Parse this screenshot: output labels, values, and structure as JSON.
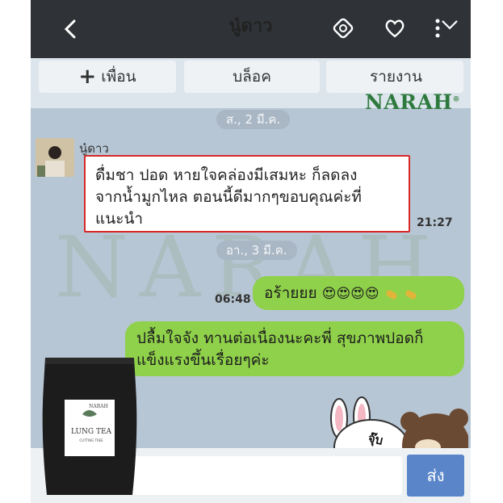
{
  "header": {
    "title": "นู๋ดาว",
    "back_icon": "chevron-left-icon",
    "icons": [
      "sync-icon",
      "heart-icon",
      "more-icon"
    ]
  },
  "actions": {
    "add_friend": "เพื่อน",
    "block": "บล็อค",
    "report": "รายงาน"
  },
  "brand": {
    "name": "NARAH",
    "mark": "®",
    "color": "#2e7a3e"
  },
  "watermark": "NARAH",
  "dates": {
    "first": "ส., 2 มี.ค.",
    "second": "อา., 3 มี.ค."
  },
  "messages": {
    "incoming": {
      "sender": "นู๋ดาว",
      "text_line1": "ดื่มชา ปอด หายใจคล่องมีเสมหะ ก็ลดลง",
      "text_line2": "จากน้ำมูกไหล ตอนนี้ดีมากๆขอบคุณค่ะที่",
      "text_line3": "แนะนำ",
      "time": "21:27"
    },
    "outgoing1": {
      "text": "อร้ายยย",
      "emoji": "😍😍😍😍",
      "time": "06:48"
    },
    "outgoing2": {
      "line1": "ปลื้มใจจัง ทานต่อเนื่องนะคะพี่ สุขภาพปอดก็",
      "line2": "แข็งแรงขึ้นเรื่อยๆค่ะ"
    }
  },
  "product": {
    "brand": "NARAH",
    "name": "LUNG TEA",
    "sub": "CUTTING TREE"
  },
  "sticker": {
    "text": "จุ๊บ"
  },
  "input": {
    "send": "ส่ง"
  },
  "colors": {
    "header": "#2f3237",
    "chat_bg": "#b7c6d4",
    "bubble_out": "#8fd14a",
    "send_button": "#5a86c9",
    "highlight": "#d62828"
  }
}
